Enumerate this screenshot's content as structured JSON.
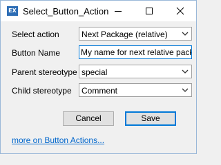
{
  "window": {
    "title": "Select_Button_Action",
    "icon_text": "EX"
  },
  "form": {
    "select_action": {
      "label": "Select action",
      "value": "Next Package (relative)"
    },
    "button_name": {
      "label": "Button Name",
      "value": "My name for next relative pack..."
    },
    "parent_stereotype": {
      "label": "Parent stereotype",
      "value": "special"
    },
    "child_stereotype": {
      "label": "Child stereotype",
      "value": "Comment"
    }
  },
  "buttons": {
    "cancel": "Cancel",
    "save": "Save"
  },
  "link": "more on Button Actions...",
  "colors": {
    "accent": "#0078d7",
    "link": "#0066cc",
    "icon_bg": "#2d6db5"
  }
}
